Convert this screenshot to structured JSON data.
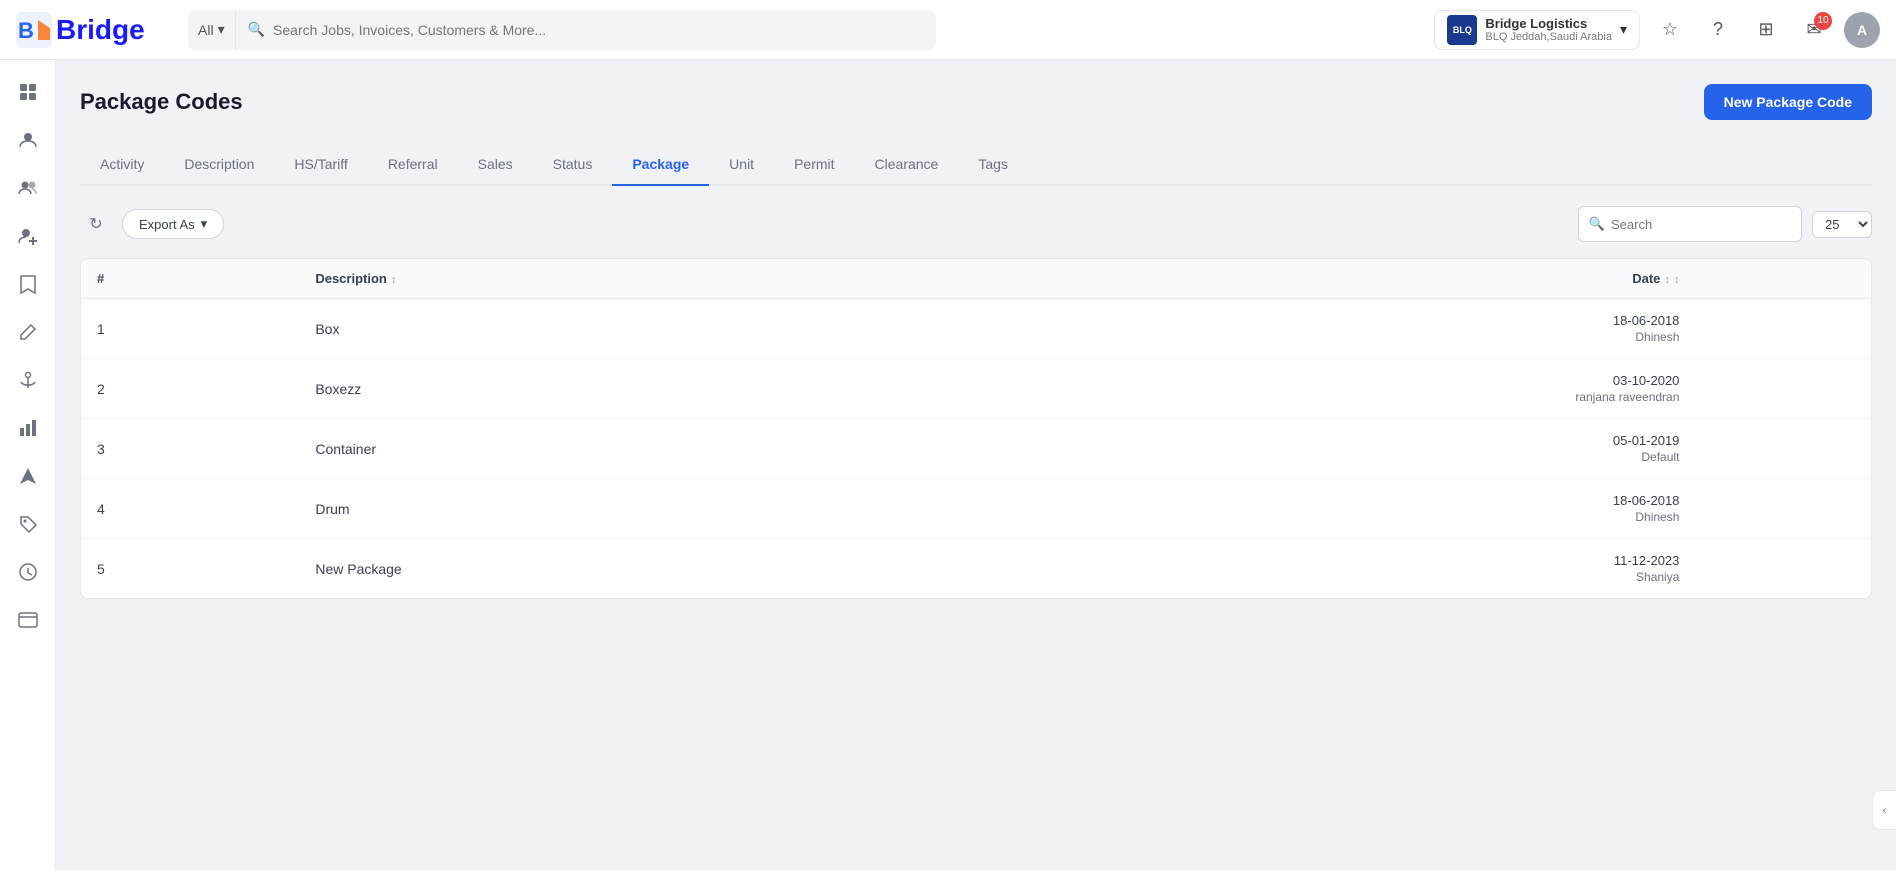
{
  "app": {
    "logo_text": "Bridge",
    "search_placeholder": "Search Jobs, Invoices, Customers & More...",
    "search_filter": "All"
  },
  "company": {
    "name": "Bridge Logistics",
    "sub": "BLQ Jeddah,Saudi Arabia",
    "logo_letters": "BLQ"
  },
  "nav": {
    "notification_count": "10",
    "avatar_letter": "A"
  },
  "sidebar": {
    "items": [
      {
        "name": "dashboard",
        "icon": "⊞"
      },
      {
        "name": "people",
        "icon": "👤"
      },
      {
        "name": "users",
        "icon": "👥"
      },
      {
        "name": "add-user",
        "icon": "👤+"
      },
      {
        "name": "bookmark",
        "icon": "🔖"
      },
      {
        "name": "edit",
        "icon": "✏️"
      },
      {
        "name": "anchor",
        "icon": "⚓"
      },
      {
        "name": "chart",
        "icon": "📊"
      },
      {
        "name": "navigation",
        "icon": "🧭"
      },
      {
        "name": "tag",
        "icon": "🏷"
      },
      {
        "name": "clock",
        "icon": "🕐"
      },
      {
        "name": "card",
        "icon": "💳"
      }
    ]
  },
  "page": {
    "title": "Package Codes",
    "new_button_label": "New Package Code"
  },
  "tabs": [
    {
      "label": "Activity",
      "active": false
    },
    {
      "label": "Description",
      "active": false
    },
    {
      "label": "HS/Tariff",
      "active": false
    },
    {
      "label": "Referral",
      "active": false
    },
    {
      "label": "Sales",
      "active": false
    },
    {
      "label": "Status",
      "active": false
    },
    {
      "label": "Package",
      "active": true
    },
    {
      "label": "Unit",
      "active": false
    },
    {
      "label": "Permit",
      "active": false
    },
    {
      "label": "Clearance",
      "active": false
    },
    {
      "label": "Tags",
      "active": false
    }
  ],
  "toolbar": {
    "export_label": "Export As",
    "search_placeholder": "Search",
    "per_page": "25"
  },
  "table": {
    "columns": [
      {
        "label": "#",
        "sortable": false
      },
      {
        "label": "Description",
        "sortable": true
      },
      {
        "label": "Date",
        "sortable": true
      }
    ],
    "rows": [
      {
        "num": "1",
        "description": "Box",
        "date": "18-06-2018",
        "user": "Dhinesh"
      },
      {
        "num": "2",
        "description": "Boxezz",
        "date": "03-10-2020",
        "user": "ranjana raveendran"
      },
      {
        "num": "3",
        "description": "Container",
        "date": "05-01-2019",
        "user": "Default"
      },
      {
        "num": "4",
        "description": "Drum",
        "date": "18-06-2018",
        "user": "Dhinesh"
      },
      {
        "num": "5",
        "description": "New Package",
        "date": "11-12-2023",
        "user": "Shaniya"
      }
    ]
  }
}
